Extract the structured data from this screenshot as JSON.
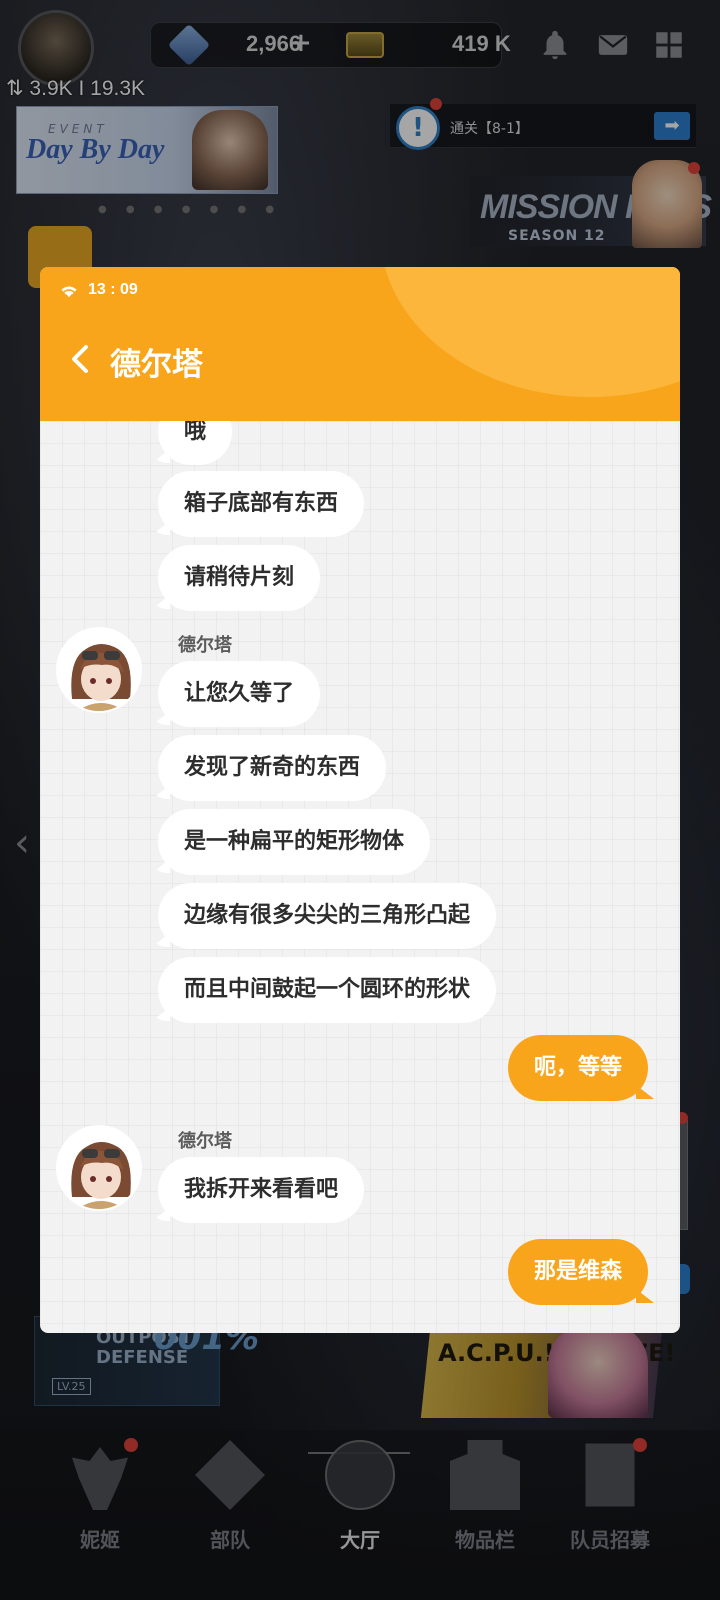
{
  "status": {
    "net_stat": "⇅ 3.9K I 19.3K"
  },
  "topbar": {
    "gems": "2,966",
    "gems_plus": "+",
    "credits": "419 K",
    "icons": [
      "bell-icon",
      "mail-icon",
      "menu-grid-icon"
    ]
  },
  "lobby": {
    "event_small": "EVENT",
    "event_title": "Day By Day",
    "quest_icon": "!",
    "quest_text": "通关【8-1】",
    "quest_arrow": "➡",
    "mission_pass_title": "MISSION PASS",
    "mission_pass_season": "SEASON 12",
    "dots": "● ● ● ● ● ● ●",
    "outpost_text": "OUTPOST DEFENSE",
    "outpost_pct": "001%",
    "outpost_lv": "LV.25",
    "freeze_text": "A.C.P.U.! FREEZE!",
    "left_arrow": "‹",
    "right_arrow": "›"
  },
  "chat": {
    "time": "13 : 09",
    "title": "德尔塔",
    "sender_name": "德尔塔",
    "messages": [
      {
        "side": "left",
        "text": "哦"
      },
      {
        "side": "left",
        "text": "箱子底部有东西"
      },
      {
        "side": "left",
        "text": "请稍待片刻"
      },
      {
        "side": "left",
        "text": "让您久等了"
      },
      {
        "side": "left",
        "text": "发现了新奇的东西"
      },
      {
        "side": "left",
        "text": "是一种扁平的矩形物体"
      },
      {
        "side": "left",
        "text": "边缘有很多尖尖的三角形凸起"
      },
      {
        "side": "left",
        "text": "而且中间鼓起一个圆环的形状"
      },
      {
        "side": "right",
        "text": "呃，等等"
      },
      {
        "side": "left",
        "text": "我拆开来看看吧"
      },
      {
        "side": "right",
        "text": "那是维森"
      }
    ]
  },
  "bottom_nav": {
    "items": [
      {
        "label": "妮姬",
        "icon": "nikke-icon",
        "badge": true
      },
      {
        "label": "部队",
        "icon": "squad-icon",
        "badge": false
      },
      {
        "label": "大厅",
        "icon": "lobby-icon",
        "badge": false,
        "active": true
      },
      {
        "label": "物品栏",
        "icon": "inventory-icon",
        "badge": false
      },
      {
        "label": "队员招募",
        "icon": "recruit-icon",
        "badge": true
      }
    ]
  },
  "colors": {
    "accent": "#f9a51c",
    "badge": "#e0413a"
  }
}
